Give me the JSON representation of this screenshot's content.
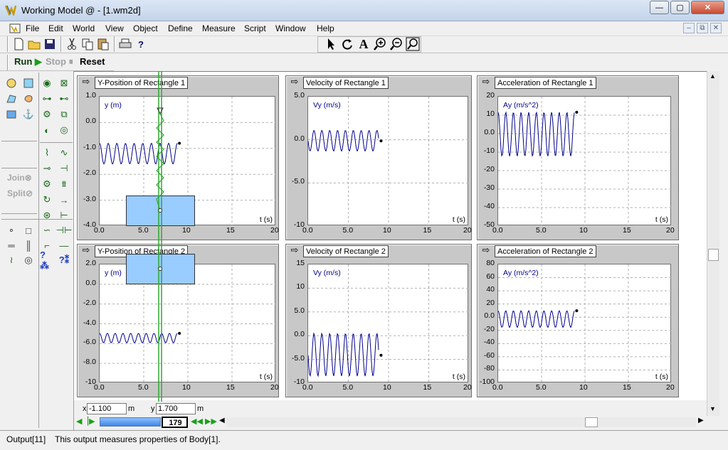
{
  "window": {
    "title": "Working Model @ - [1.wm2d]",
    "min_label": "—",
    "max_label": "▢",
    "close_label": "✕"
  },
  "menu": [
    "File",
    "Edit",
    "World",
    "View",
    "Object",
    "Define",
    "Measure",
    "Script",
    "Window",
    "Help"
  ],
  "mdi_buttons": [
    "–",
    "⧉",
    "✕"
  ],
  "runbar": {
    "run": "Run",
    "stop": "Stop",
    "reset": "Reset"
  },
  "toolbox": {
    "join": "Join",
    "split": "Split"
  },
  "meters": [
    {
      "label": "Y-Position of Rectangle 1",
      "ylabel": "y (m)",
      "xlabel": "t (s)",
      "yticks": [
        "1.0",
        "0.0",
        "-1.0",
        "-2.0",
        "-3.0",
        "-4.0"
      ],
      "xticks": [
        "0.0",
        "5.0",
        "10",
        "15",
        "20"
      ]
    },
    {
      "label": "Velocity of Rectangle 1",
      "ylabel": "Vy (m/s)",
      "xlabel": "t (s)",
      "yticks": [
        "5.0",
        "0.0",
        "-5.0",
        "-10"
      ],
      "xticks": [
        "0.0",
        "5.0",
        "10",
        "15",
        "20"
      ]
    },
    {
      "label": "Acceleration of Rectangle 1",
      "ylabel": "Ay (m/s^2)",
      "xlabel": "t (s)",
      "yticks": [
        "20",
        "10",
        "0.0",
        "-10",
        "-20",
        "-30",
        "-40",
        "-50"
      ],
      "xticks": [
        "0.0",
        "5.0",
        "10",
        "15",
        "20"
      ]
    },
    {
      "label": "Y-Position of Rectangle 2",
      "ylabel": "y (m)",
      "xlabel": "t (s)",
      "yticks": [
        "2.0",
        "0.0",
        "-2.0",
        "-4.0",
        "-6.0",
        "-8.0",
        "-10"
      ],
      "xticks": [
        "0.0",
        "5.0",
        "10",
        "15",
        "20"
      ]
    },
    {
      "label": "Velocity of Rectangle 2",
      "ylabel": "Vy (m/s)",
      "xlabel": "t (s)",
      "yticks": [
        "15",
        "10",
        "5.0",
        "0.0",
        "-5.0",
        "-10"
      ],
      "xticks": [
        "0.0",
        "5.0",
        "10",
        "15",
        "20"
      ]
    },
    {
      "label": "Acceleration of Rectangle 2",
      "ylabel": "Ay (m/s^2)",
      "xlabel": "t (s)",
      "yticks": [
        "80",
        "60",
        "40",
        "20",
        "0.0",
        "-20",
        "-40",
        "-60",
        "-80",
        "-100"
      ],
      "xticks": [
        "0.0",
        "5.0",
        "10",
        "15",
        "20"
      ]
    }
  ],
  "coords": {
    "x_label": "x",
    "x_value": "-1.100",
    "x_unit": "m",
    "y_label": "y",
    "y_value": "1.700",
    "y_unit": "m"
  },
  "frame": {
    "value": "179"
  },
  "status": {
    "left": "Output[11]",
    "message": "This output measures properties of Body[1]."
  },
  "colors": {
    "trace": "#00008b",
    "body_fill": "#99ccff",
    "spring": "#2ea82e",
    "meter_bg": "#c8c8c8"
  }
}
